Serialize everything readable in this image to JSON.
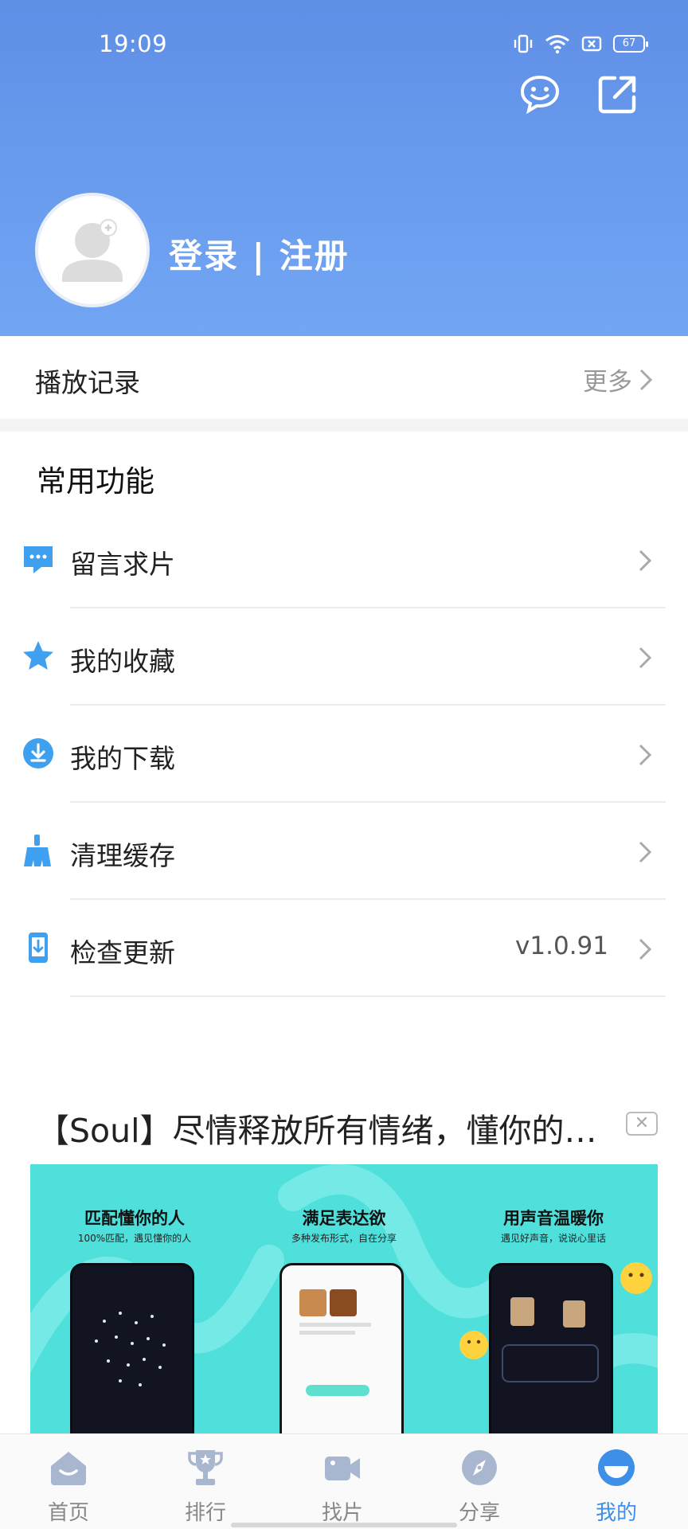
{
  "status_bar": {
    "time": "19:09",
    "battery": "67"
  },
  "header": {
    "login_label": "登录 | 注册",
    "icons": [
      "message-bubble-icon",
      "share-external-icon"
    ]
  },
  "history": {
    "title": "播放记录",
    "more": "更多"
  },
  "common": {
    "title": "常用功能",
    "items": [
      {
        "label": "留言求片",
        "icon": "message-icon",
        "value": ""
      },
      {
        "label": "我的收藏",
        "icon": "star-icon",
        "value": ""
      },
      {
        "label": "我的下载",
        "icon": "download-icon",
        "value": ""
      },
      {
        "label": "清理缓存",
        "icon": "broom-icon",
        "value": ""
      },
      {
        "label": "检查更新",
        "icon": "update-icon",
        "value": "v1.0.91"
      }
    ]
  },
  "ad": {
    "title": "【Soul】尽情释放所有情绪，懂你的…",
    "close": "✕",
    "panels": [
      {
        "heading": "匹配懂你的人",
        "sub": "100%匹配，遇见懂你的人"
      },
      {
        "heading": "满足表达欲",
        "sub": "多种发布形式，自在分享"
      },
      {
        "heading": "用声音温暖你",
        "sub": "遇见好声音，说说心里话"
      }
    ]
  },
  "nav": {
    "items": [
      {
        "label": "首页",
        "icon": "home-icon"
      },
      {
        "label": "排行",
        "icon": "trophy-icon"
      },
      {
        "label": "找片",
        "icon": "video-camera-icon"
      },
      {
        "label": "分享",
        "icon": "compass-icon"
      },
      {
        "label": "我的",
        "icon": "profile-icon"
      }
    ],
    "active_index": 4
  },
  "colors": {
    "accent": "#3d8fe8",
    "header_top": "#5f8fe6",
    "header_bottom": "#72a6f4",
    "ad_bg": "#4fe0dc"
  }
}
